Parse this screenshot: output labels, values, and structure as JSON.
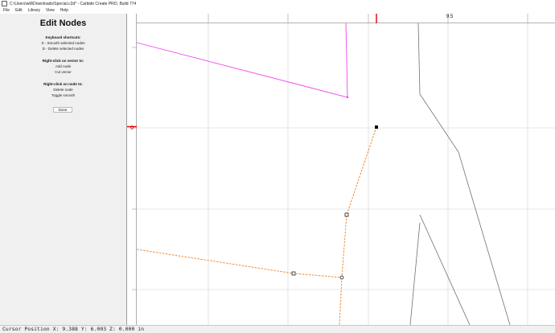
{
  "window": {
    "title": "C:\\Users\\will\\Downloads\\Special.c2d* - Carbide Create PRO, Build 774"
  },
  "menu": {
    "items": [
      {
        "label": "File"
      },
      {
        "label": "Edit"
      },
      {
        "label": "Library"
      },
      {
        "label": "View"
      },
      {
        "label": "Help"
      }
    ]
  },
  "panel": {
    "heading": "Edit Nodes",
    "shortcuts_heading": "Keyboard shortcuts:",
    "shortcuts": [
      "S - Smooth selected nodes",
      "D - Delete selected nodes"
    ],
    "vector_heading": "Right-click on vector to:",
    "vector_actions": [
      "Add node",
      "Cut vector"
    ],
    "node_heading": "Right-click on node to:",
    "node_actions": [
      "Delete node",
      "Toggle smooth"
    ],
    "done_label": "Done"
  },
  "ruler": {
    "label": "9.5"
  },
  "colors": {
    "magenta_vector": "#ee44ee",
    "orange_vector": "#f08a30",
    "gray_vector": "#707070",
    "cursor_marker": "#dd0000",
    "grid": "#d0d0d0"
  },
  "status": {
    "cursor_position": "Cursor Position X: 9.388 Y: 6.003 Z: 0.000 in"
  }
}
